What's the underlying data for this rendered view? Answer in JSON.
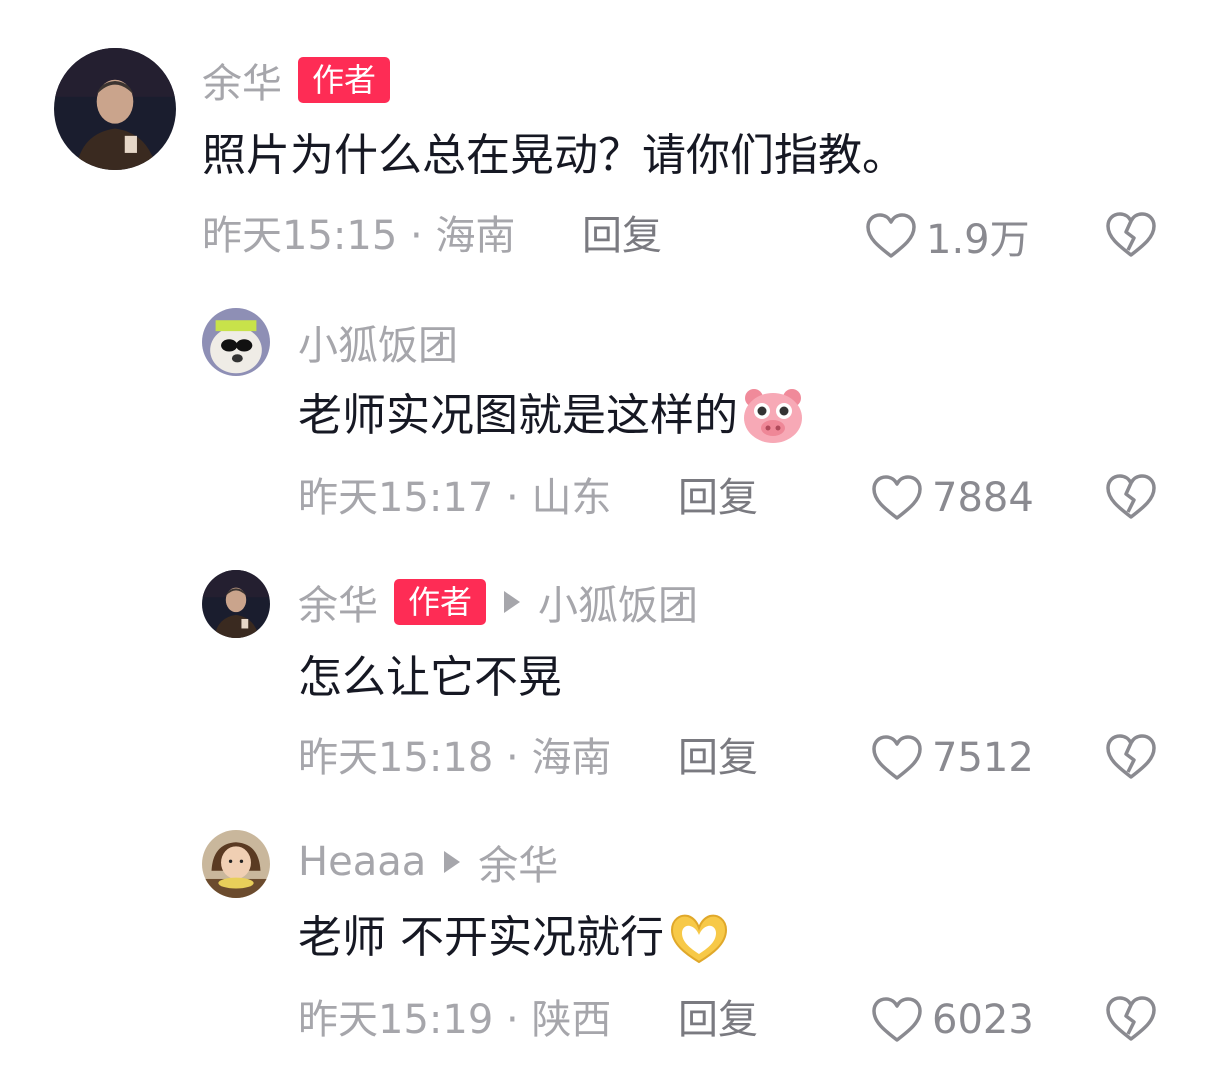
{
  "comments": [
    {
      "author": "余华",
      "badge": "作者",
      "text": "照片为什么总在晃动？请你们指教。",
      "time": "昨天15:15",
      "location": "海南",
      "reply_label": "回复",
      "likes": "1.9万"
    },
    {
      "author": "小狐饭团",
      "text": "老师实况图就是这样的",
      "emoji": "pig-face-emoji",
      "time": "昨天15:17",
      "location": "山东",
      "reply_label": "回复",
      "likes": "7884"
    },
    {
      "author": "余华",
      "badge": "作者",
      "reply_to": "小狐饭团",
      "text": "怎么让它不晃",
      "time": "昨天15:18",
      "location": "海南",
      "reply_label": "回复",
      "likes": "7512"
    },
    {
      "author": "Heaaa",
      "reply_to": "余华",
      "text": "老师 不开实况就行",
      "emoji": "heart-hands-emoji",
      "time": "昨天15:19",
      "location": "陕西",
      "reply_label": "回复",
      "likes": "6023"
    }
  ],
  "separator": " · ",
  "colors": {
    "badge": "#fe2c55",
    "secondary_text": "#a6a6ab",
    "primary_text": "#161823"
  },
  "icons": [
    "heart-outline-icon",
    "broken-heart-icon",
    "reply-arrow-icon"
  ]
}
